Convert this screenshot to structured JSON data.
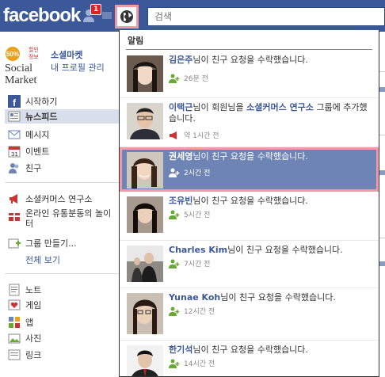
{
  "header": {
    "logo": "facebook",
    "friend_badge": "1",
    "search_placeholder": "검색"
  },
  "profile": {
    "logo_top": "할인정보",
    "logo_num": "50%",
    "logo_line1": "Social",
    "logo_line2": "Market",
    "name": "소셜마켓",
    "edit": "내 프로필 관리"
  },
  "nav": [
    {
      "label": "시작하기",
      "icon": "facebook-icon"
    },
    {
      "label": "뉴스피드",
      "icon": "news-feed-icon"
    },
    {
      "label": "메시지",
      "icon": "messages-icon"
    },
    {
      "label": "이벤트",
      "icon": "events-icon"
    },
    {
      "label": "친구",
      "icon": "friends-icon"
    },
    {
      "label": "소셜커머스 연구소",
      "icon": "megaphone-icon"
    },
    {
      "label": "온라인 유통분동의 놀이터",
      "icon": "gift-icon"
    },
    {
      "label": "그룹 만들기...",
      "icon": "create-group-icon"
    },
    {
      "label": "전체 보기",
      "icon": ""
    },
    {
      "label": "노트",
      "icon": "notes-icon"
    },
    {
      "label": "게임",
      "icon": "games-icon"
    },
    {
      "label": "앱",
      "icon": "apps-icon"
    },
    {
      "label": "사진",
      "icon": "photos-icon"
    },
    {
      "label": "링크",
      "icon": "links-icon"
    }
  ],
  "panel": {
    "title": "알림",
    "items": [
      {
        "name": "김은주",
        "text": "님이 친구 요청을 수락했습니다.",
        "time": "26분 전",
        "icon": "friend-icon"
      },
      {
        "name": "이택근",
        "text": "님이 회원님을 ",
        "name2": "소셜커머스 연구소",
        "text2": " 그룹에 추가했습니다.",
        "time": "약 1시간 전",
        "icon": "megaphone-icon"
      },
      {
        "name": "권세영",
        "text": "님이 친구 요청을 수락했습니다.",
        "time": "2시간 전",
        "icon": "friend-icon"
      },
      {
        "name": "조유빈",
        "text": "님이 친구 요청을 수락했습니다.",
        "time": "5시간 전",
        "icon": "friend-icon"
      },
      {
        "name": "Charles Kim",
        "text": "님이 친구 요청을 수락했습니다.",
        "time": "7시간 전",
        "icon": "friend-icon"
      },
      {
        "name": "Yunae Koh",
        "text": "님이 친구 요청을 수락했습니다.",
        "time": "12시간 전",
        "icon": "friend-icon"
      },
      {
        "name": "한기석",
        "text": "님이 친구 요청을 수락했습니다.",
        "time": "14시간 전",
        "icon": "friend-icon"
      }
    ]
  },
  "colors": {
    "brand": "#3b5998",
    "highlight": "#6d84b4",
    "annotation": "#f29ba6"
  }
}
